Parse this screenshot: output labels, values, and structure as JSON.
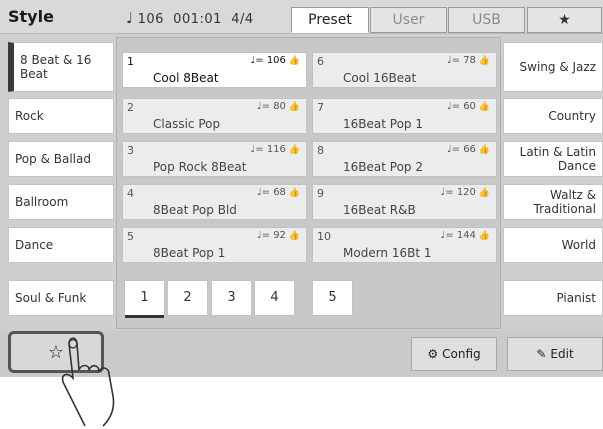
{
  "header": {
    "title": "Style",
    "tempo": "106",
    "position": "001:01",
    "meter": "4/4",
    "tabs": [
      "Preset",
      "User",
      "USB"
    ]
  },
  "left_categories": [
    "8 Beat & 16 Beat",
    "Rock",
    "Pop & Ballad",
    "Ballroom",
    "Dance",
    "Soul & Funk"
  ],
  "right_categories": [
    "Swing & Jazz",
    "Country",
    "Latin & Latin Dance",
    "Waltz & Traditional",
    "World",
    "Pianist"
  ],
  "styles_col1": [
    {
      "num": "1",
      "tempo": "♩= 106",
      "name": "Cool 8Beat"
    },
    {
      "num": "2",
      "tempo": "♩= 80",
      "name": "Classic Pop"
    },
    {
      "num": "3",
      "tempo": "♩= 116",
      "name": "Pop Rock 8Beat"
    },
    {
      "num": "4",
      "tempo": "♩= 68",
      "name": "8Beat Pop Bld"
    },
    {
      "num": "5",
      "tempo": "♩= 92",
      "name": "8Beat Pop 1"
    }
  ],
  "styles_col2": [
    {
      "num": "6",
      "tempo": "♩= 78",
      "name": "Cool 16Beat"
    },
    {
      "num": "7",
      "tempo": "♩= 60",
      "name": "16Beat Pop 1"
    },
    {
      "num": "8",
      "tempo": "♩= 66",
      "name": "16Beat Pop 2"
    },
    {
      "num": "9",
      "tempo": "♩= 120",
      "name": "16Beat R&B"
    },
    {
      "num": "10",
      "tempo": "♩= 144",
      "name": "Modern 16Bt 1"
    }
  ],
  "pages": [
    "1",
    "2",
    "3",
    "4",
    "5"
  ],
  "buttons": {
    "config": "Config",
    "edit": "Edit"
  }
}
